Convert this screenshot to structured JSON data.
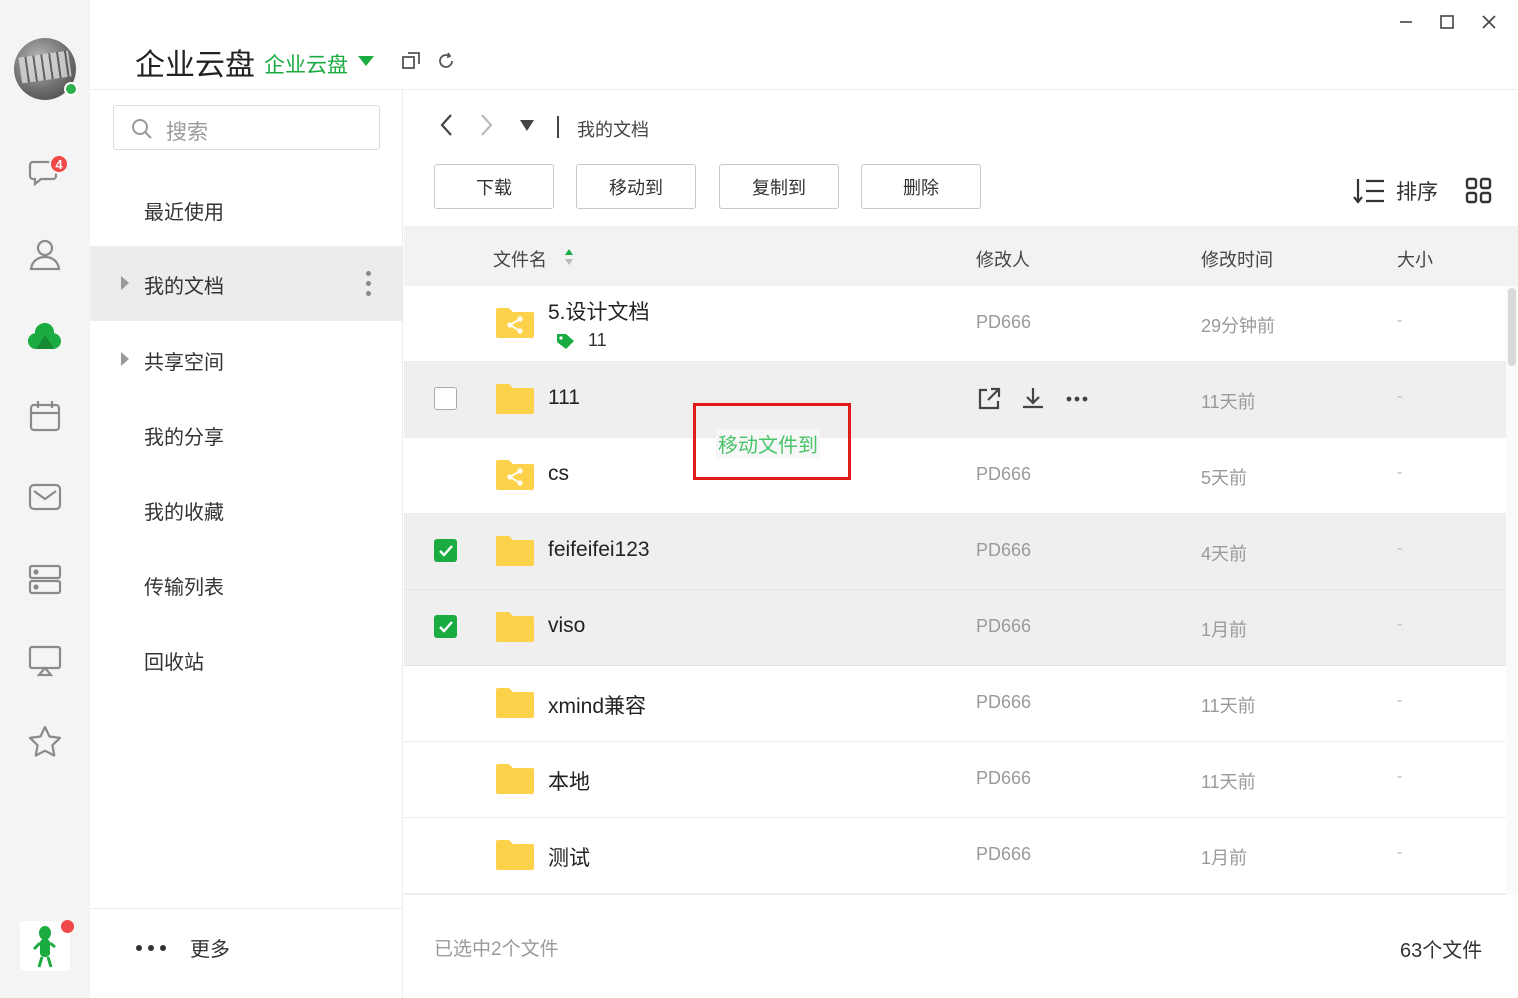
{
  "app": {
    "title": "企业云盘",
    "space": "企业云盘"
  },
  "rail": {
    "chat_badge": "4"
  },
  "search": {
    "placeholder": "搜索"
  },
  "nav": {
    "items": [
      {
        "label": "最近使用"
      },
      {
        "label": "我的文档"
      },
      {
        "label": "共享空间"
      },
      {
        "label": "我的分享"
      },
      {
        "label": "我的收藏"
      },
      {
        "label": "传输列表"
      },
      {
        "label": "回收站"
      }
    ],
    "more": "更多"
  },
  "breadcrumb": {
    "current": "我的文档"
  },
  "toolbar": {
    "download": "下载",
    "move": "移动到",
    "copy": "复制到",
    "delete": "删除",
    "sort": "排序"
  },
  "columns": {
    "name": "文件名",
    "modifier": "修改人",
    "modified": "修改时间",
    "size": "大小"
  },
  "files": [
    {
      "name": "5.设计文档",
      "tag_count": "11",
      "modifier": "PD666",
      "modified": "29分钟前",
      "size": "-"
    },
    {
      "name": "111",
      "modifier": "",
      "modified": "11天前",
      "size": "-"
    },
    {
      "name": "cs",
      "modifier": "PD666",
      "modified": "5天前",
      "size": "-"
    },
    {
      "name": "feifeifei123",
      "modifier": "PD666",
      "modified": "4天前",
      "size": "-"
    },
    {
      "name": "viso",
      "modifier": "PD666",
      "modified": "1月前",
      "size": "-"
    },
    {
      "name": "xmind兼容",
      "modifier": "PD666",
      "modified": "11天前",
      "size": "-"
    },
    {
      "name": "本地",
      "modifier": "PD666",
      "modified": "11天前",
      "size": "-"
    },
    {
      "name": "测试",
      "modifier": "PD666",
      "modified": "1月前",
      "size": "-"
    }
  ],
  "tooltip": "移动文件到",
  "status": {
    "selected": "已选中2个文件",
    "total": "63个文件"
  },
  "colors": {
    "accent": "#1aab41",
    "badge": "#f04848",
    "folder": "#fcd24a",
    "highlight_border": "#e21b1b"
  }
}
